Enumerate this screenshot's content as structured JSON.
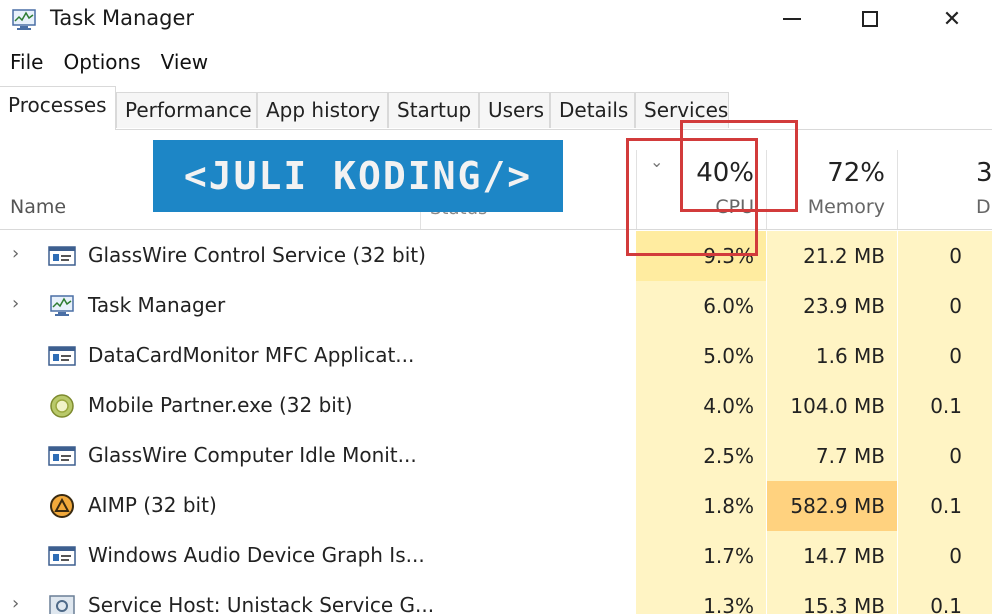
{
  "window": {
    "title": "Task Manager",
    "app_icon": "task-manager-icon",
    "controls": {
      "minimize": "minimize-icon",
      "maximize": "maximize-icon",
      "close": "close-icon",
      "close_glyph": "✕"
    }
  },
  "menu": [
    "File",
    "Options",
    "View"
  ],
  "tabs": [
    "Processes",
    "Performance",
    "App history",
    "Startup",
    "Users",
    "Details",
    "Services"
  ],
  "active_tab": "Processes",
  "overlay_banner": "<JULI KODING/>",
  "columns": {
    "name": "Name",
    "status": "Status",
    "cpu": {
      "percent": "40%",
      "label": "CPU"
    },
    "memory": {
      "percent": "72%",
      "label": "Memory"
    },
    "disk": {
      "percent": "3",
      "label": "D"
    }
  },
  "processes": [
    {
      "expandable": true,
      "icon": "service-window-icon",
      "name": "GlassWire Control Service (32 bit)",
      "cpu": "9.3%",
      "memory": "21.2 MB",
      "disk": "0"
    },
    {
      "expandable": true,
      "icon": "task-manager-icon",
      "name": "Task Manager",
      "cpu": "6.0%",
      "memory": "23.9 MB",
      "disk": "0"
    },
    {
      "expandable": false,
      "icon": "service-window-icon",
      "name": "DataCardMonitor MFC Applicat...",
      "cpu": "5.0%",
      "memory": "1.6 MB",
      "disk": "0"
    },
    {
      "expandable": false,
      "icon": "mobile-partner-icon",
      "name": "Mobile Partner.exe (32 bit)",
      "cpu": "4.0%",
      "memory": "104.0 MB",
      "disk": "0.1"
    },
    {
      "expandable": false,
      "icon": "service-window-icon",
      "name": "GlassWire Computer Idle Monit...",
      "cpu": "2.5%",
      "memory": "7.7 MB",
      "disk": "0"
    },
    {
      "expandable": false,
      "icon": "aimp-icon",
      "name": "AIMP (32 bit)",
      "cpu": "1.8%",
      "memory": "582.9 MB",
      "disk": "0.1"
    },
    {
      "expandable": false,
      "icon": "service-window-icon",
      "name": "Windows Audio Device Graph Is...",
      "cpu": "1.7%",
      "memory": "14.7 MB",
      "disk": "0"
    },
    {
      "expandable": true,
      "icon": "service-host-icon",
      "name": "Service Host: Unistack Service G...",
      "cpu": "1.3%",
      "memory": "15.3 MB",
      "disk": "0.1"
    }
  ],
  "expand_glyph": "›",
  "sort_glyph": "⌄",
  "colors": {
    "heat_light": "#fff4c4",
    "heat_medium": "#ffeca0",
    "heat_strong": "#ffd27f",
    "banner": "#1d86c6",
    "highlight": "#d23b3b"
  }
}
